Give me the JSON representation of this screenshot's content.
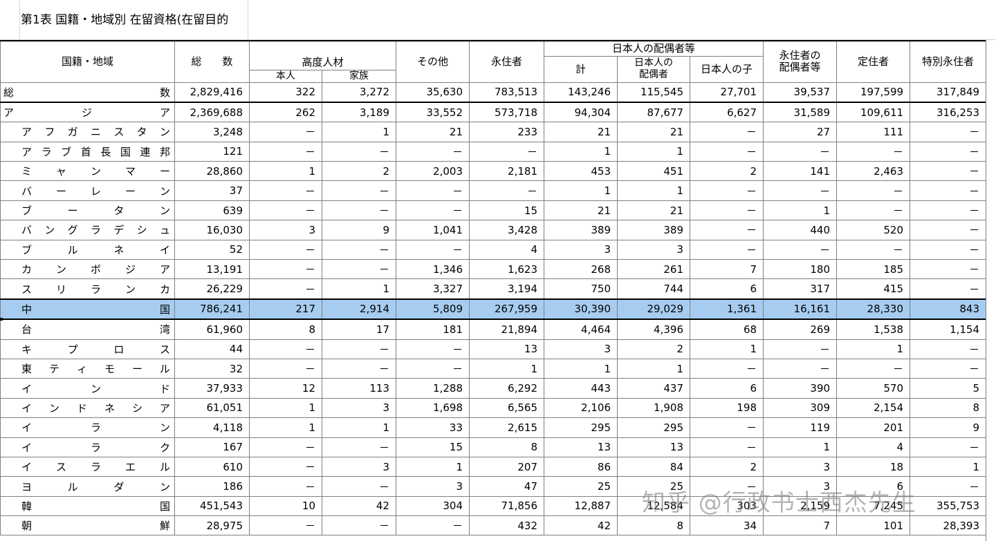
{
  "title": "第1表 国籍・地域別 在留資格(在留目的",
  "headers": {
    "country": "国籍・地域",
    "total": "総　　数",
    "highly_skilled": "高度人材",
    "hs_self": "本人",
    "hs_family": "家族",
    "other": "その他",
    "permanent": "永住者",
    "spouse_group": "日本人の配偶者等",
    "spouse_total": "計",
    "spouse_of_japanese": "日本人の\n配偶者",
    "child_of_japanese": "日本人の子",
    "spouse_of_permanent": "永住者の\n配偶者等",
    "long_term": "定住者",
    "special_permanent": "特別永住者"
  },
  "rows": [
    {
      "name": "総数",
      "type": "total",
      "v": [
        "2,829,416",
        "322",
        "3,272",
        "35,630",
        "783,513",
        "143,246",
        "115,545",
        "27,701",
        "39,537",
        "197,599",
        "317,849"
      ]
    },
    {
      "name": "アジア",
      "type": "region",
      "v": [
        "2,369,688",
        "262",
        "3,189",
        "33,552",
        "573,718",
        "94,304",
        "87,677",
        "6,627",
        "31,589",
        "109,611",
        "316,253"
      ]
    },
    {
      "name": "アフガニスタン",
      "type": "country",
      "v": [
        "3,248",
        "－",
        "1",
        "21",
        "233",
        "21",
        "21",
        "－",
        "27",
        "111",
        "－"
      ]
    },
    {
      "name": "アラブ首長国連邦",
      "type": "country",
      "v": [
        "121",
        "－",
        "－",
        "－",
        "－",
        "1",
        "1",
        "－",
        "－",
        "－",
        "－"
      ]
    },
    {
      "name": "ミャンマー",
      "type": "country",
      "v": [
        "28,860",
        "1",
        "2",
        "2,003",
        "2,181",
        "453",
        "451",
        "2",
        "141",
        "2,463",
        "－"
      ]
    },
    {
      "name": "バーレーン",
      "type": "country",
      "v": [
        "37",
        "－",
        "－",
        "－",
        "－",
        "1",
        "1",
        "－",
        "－",
        "－",
        "－"
      ]
    },
    {
      "name": "ブータン",
      "type": "country",
      "v": [
        "639",
        "－",
        "－",
        "－",
        "15",
        "21",
        "21",
        "－",
        "1",
        "－",
        "－"
      ]
    },
    {
      "name": "バングラデシュ",
      "type": "country",
      "v": [
        "16,030",
        "3",
        "9",
        "1,041",
        "3,428",
        "389",
        "389",
        "－",
        "440",
        "520",
        "－"
      ]
    },
    {
      "name": "ブルネイ",
      "type": "country",
      "v": [
        "52",
        "－",
        "－",
        "－",
        "4",
        "3",
        "3",
        "－",
        "－",
        "－",
        "－"
      ]
    },
    {
      "name": "カンボジア",
      "type": "country",
      "v": [
        "13,191",
        "－",
        "－",
        "1,346",
        "1,623",
        "268",
        "261",
        "7",
        "180",
        "185",
        "－"
      ]
    },
    {
      "name": "スリランカ",
      "type": "country",
      "v": [
        "26,229",
        "－",
        "1",
        "3,327",
        "3,194",
        "750",
        "744",
        "6",
        "317",
        "415",
        "－"
      ]
    },
    {
      "name": "中国",
      "type": "highlight",
      "v": [
        "786,241",
        "217",
        "2,914",
        "5,809",
        "267,959",
        "30,390",
        "29,029",
        "1,361",
        "16,161",
        "28,330",
        "843"
      ]
    },
    {
      "name": "台湾",
      "type": "country",
      "v": [
        "61,960",
        "8",
        "17",
        "181",
        "21,894",
        "4,464",
        "4,396",
        "68",
        "269",
        "1,538",
        "1,154"
      ]
    },
    {
      "name": "キプロス",
      "type": "country",
      "v": [
        "44",
        "－",
        "－",
        "－",
        "13",
        "3",
        "2",
        "1",
        "－",
        "1",
        "－"
      ]
    },
    {
      "name": "東ティモール",
      "type": "country",
      "v": [
        "32",
        "－",
        "－",
        "－",
        "1",
        "1",
        "1",
        "－",
        "－",
        "－",
        "－"
      ]
    },
    {
      "name": "インド",
      "type": "country",
      "v": [
        "37,933",
        "12",
        "113",
        "1,288",
        "6,292",
        "443",
        "437",
        "6",
        "390",
        "570",
        "5"
      ]
    },
    {
      "name": "インドネシア",
      "type": "country",
      "v": [
        "61,051",
        "1",
        "3",
        "1,698",
        "6,565",
        "2,106",
        "1,908",
        "198",
        "309",
        "2,154",
        "8"
      ]
    },
    {
      "name": "イラン",
      "type": "country",
      "v": [
        "4,118",
        "1",
        "1",
        "33",
        "2,615",
        "295",
        "295",
        "－",
        "119",
        "201",
        "9"
      ]
    },
    {
      "name": "イラク",
      "type": "country",
      "v": [
        "167",
        "－",
        "－",
        "15",
        "8",
        "13",
        "13",
        "－",
        "1",
        "4",
        "－"
      ]
    },
    {
      "name": "イスラエル",
      "type": "country",
      "v": [
        "610",
        "－",
        "3",
        "1",
        "207",
        "86",
        "84",
        "2",
        "3",
        "18",
        "1"
      ]
    },
    {
      "name": "ヨルダン",
      "type": "country",
      "v": [
        "186",
        "－",
        "－",
        "3",
        "47",
        "25",
        "25",
        "－",
        "3",
        "6",
        "－"
      ]
    },
    {
      "name": "韓国",
      "type": "country",
      "v": [
        "451,543",
        "10",
        "42",
        "304",
        "71,856",
        "12,887",
        "12,584",
        "303",
        "2,159",
        "7,245",
        "355,753"
      ]
    },
    {
      "name": "朝鮮",
      "type": "country",
      "v": [
        "28,975",
        "－",
        "－",
        "－",
        "432",
        "42",
        "8",
        "34",
        "7",
        "101",
        "28,393"
      ]
    }
  ],
  "watermark": "知乎 @行政书士西杰先生"
}
